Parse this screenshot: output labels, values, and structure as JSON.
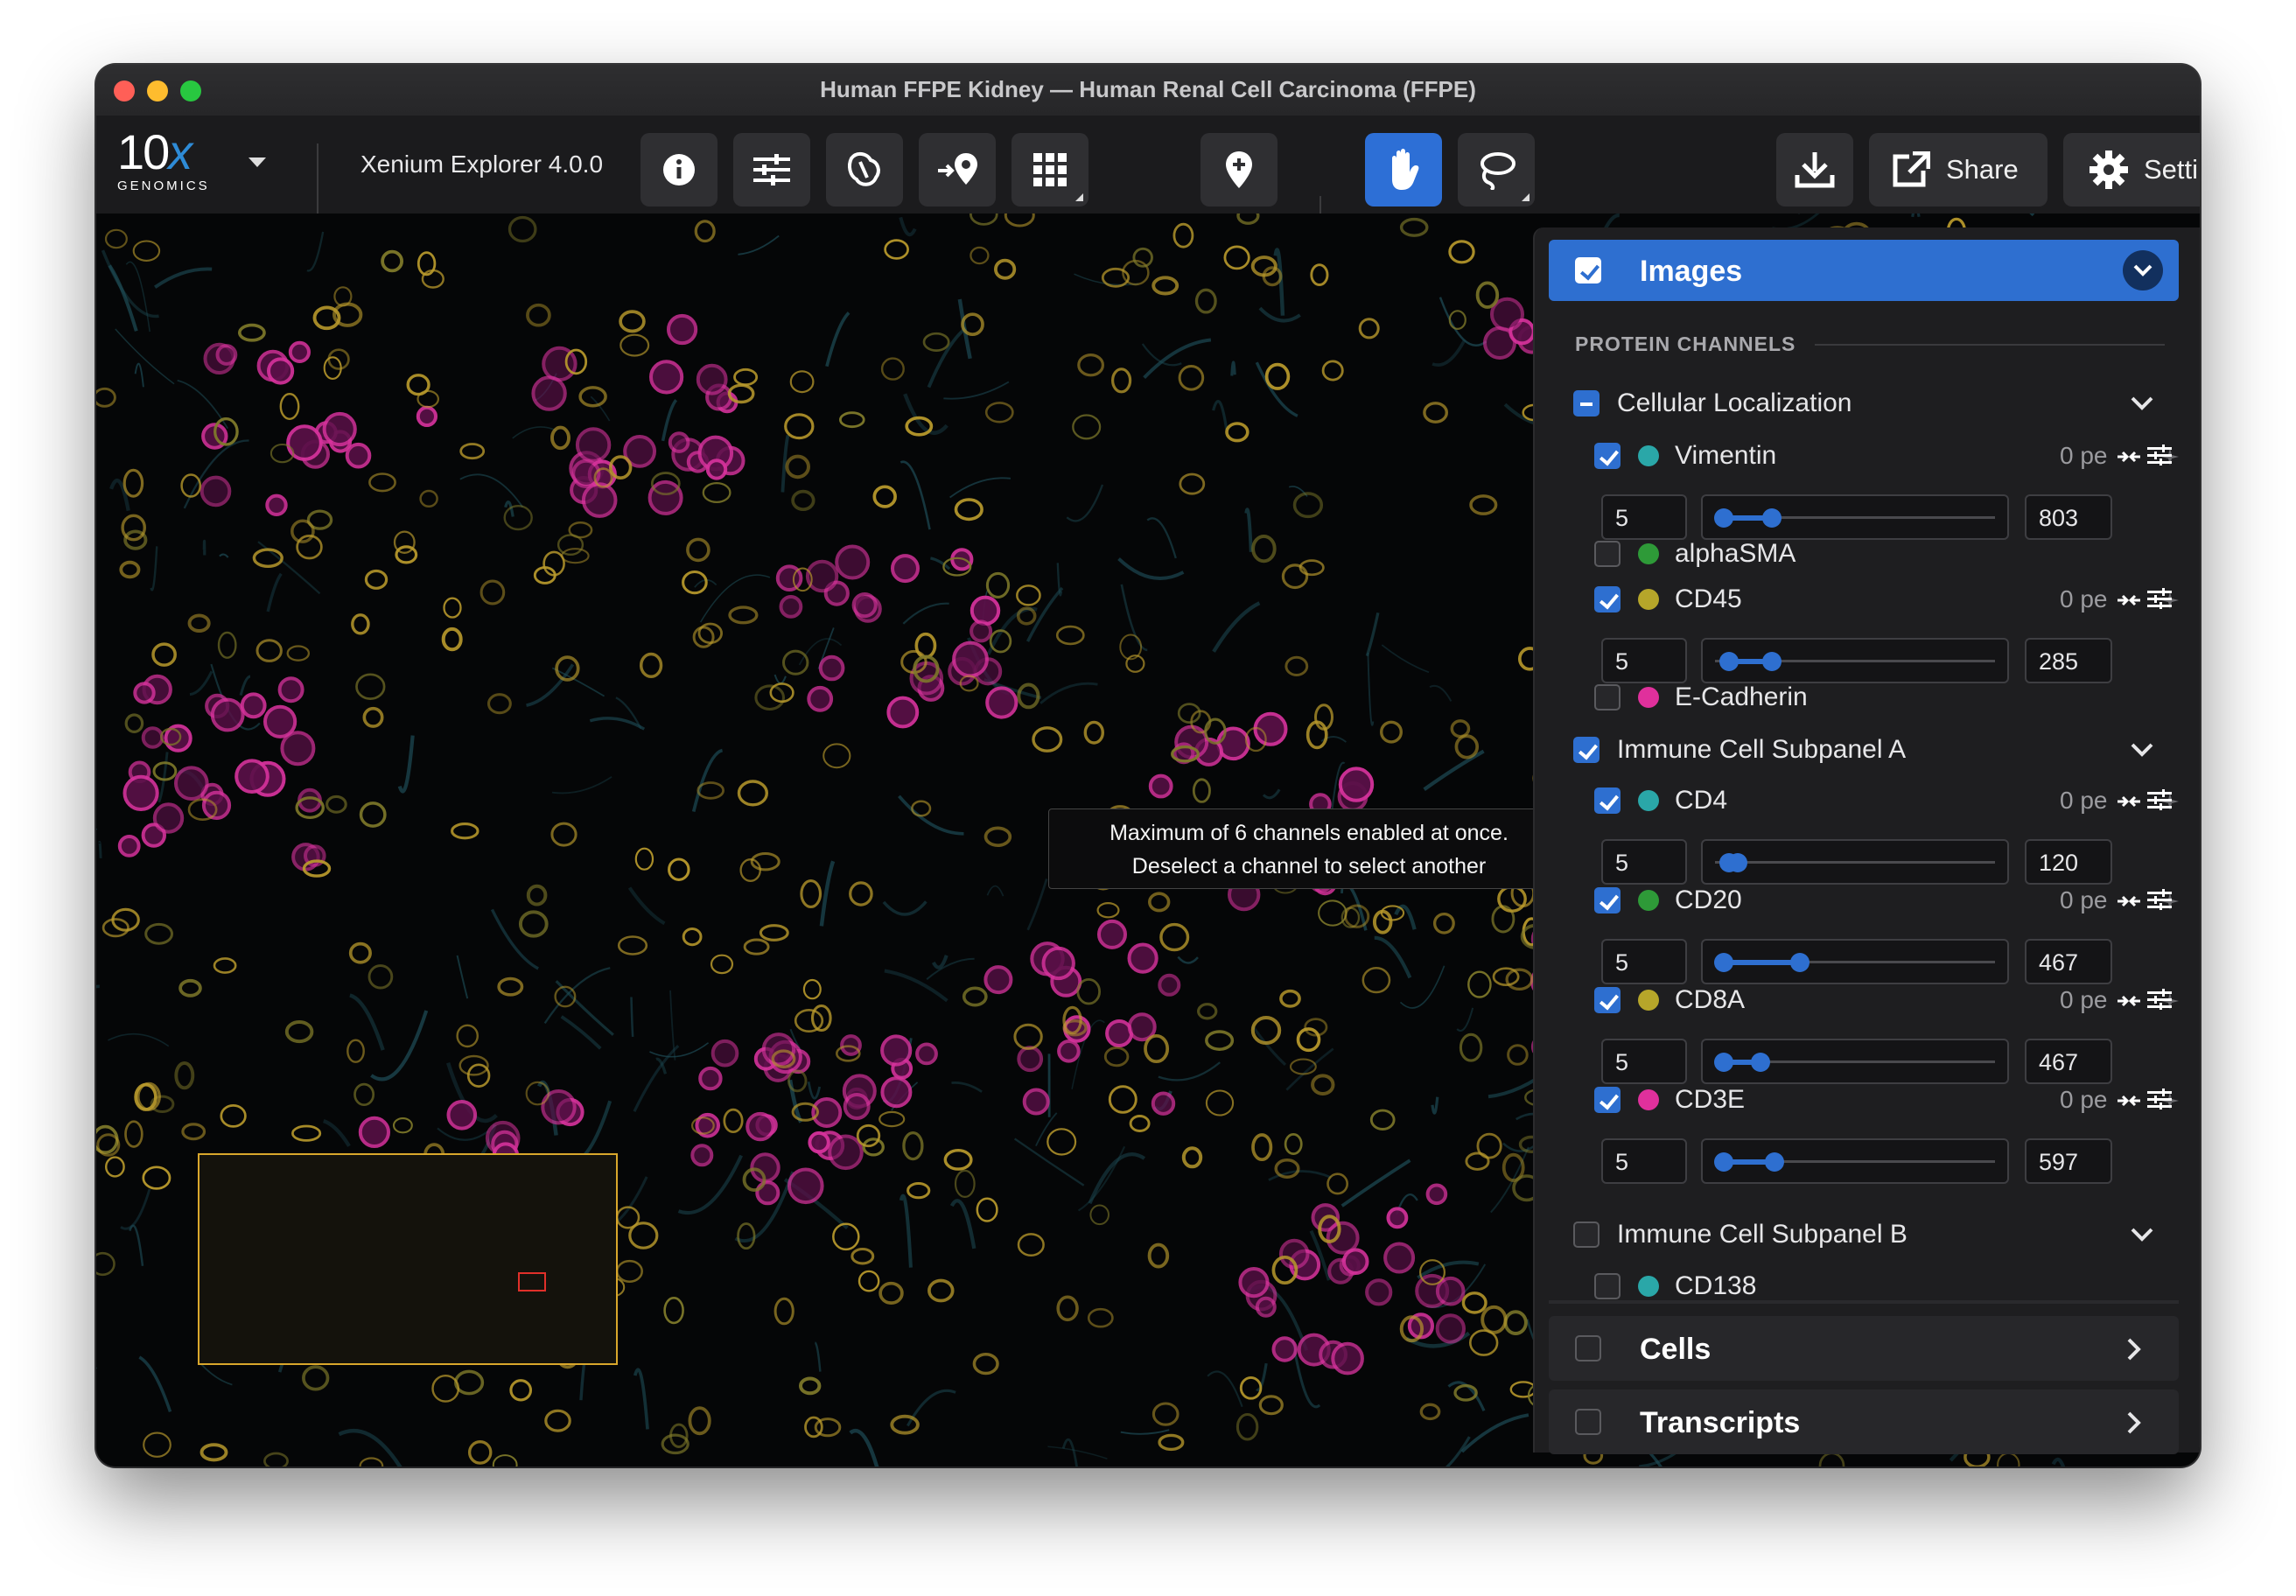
{
  "window": {
    "title": "Human FFPE Kidney — Human Renal Cell Carcinoma (FFPE)"
  },
  "toolbar": {
    "logo_main": "10",
    "logo_x": "x",
    "logo_sub": "GENOMICS",
    "app_name": "Xenium Explorer 4.0.0",
    "share_label": "Share",
    "settings_label": "Settings"
  },
  "tooltip": {
    "line1": "Maximum of 6 channels enabled at once.",
    "line2": "Deselect a channel to select another"
  },
  "panel": {
    "images_label": "Images",
    "section_title": "PROTEIN CHANNELS",
    "groups": [
      {
        "label": "Cellular Localization",
        "state": "partial"
      },
      {
        "label": "Immune Cell Subpanel A",
        "state": "checked"
      },
      {
        "label": "Immune Cell Subpanel B",
        "state": "unchecked"
      }
    ],
    "channels": [
      {
        "name": "Vimentin",
        "color": "#2aa7a8",
        "checked": true,
        "pe": "0 pe",
        "min": "5",
        "max": "803",
        "range": [
          0.03,
          0.2
        ]
      },
      {
        "name": "alphaSMA",
        "color": "#2e9a38",
        "checked": false
      },
      {
        "name": "CD45",
        "color": "#b6a62a",
        "checked": true,
        "pe": "0 pe",
        "min": "5",
        "max": "285",
        "range": [
          0.05,
          0.2
        ]
      },
      {
        "name": "E-Cadherin",
        "color": "#e0309c",
        "checked": false
      },
      {
        "name": "CD4",
        "color": "#2aa7a8",
        "checked": true,
        "pe": "0 pe",
        "min": "5",
        "max": "120",
        "range": [
          0.05,
          0.08
        ]
      },
      {
        "name": "CD20",
        "color": "#2e9a38",
        "checked": true,
        "pe": "0 pe",
        "min": "5",
        "max": "467",
        "range": [
          0.03,
          0.3
        ]
      },
      {
        "name": "CD8A",
        "color": "#b6a62a",
        "checked": true,
        "pe": "0 pe",
        "min": "5",
        "max": "467",
        "range": [
          0.03,
          0.16
        ]
      },
      {
        "name": "CD3E",
        "color": "#e0309c",
        "checked": true,
        "pe": "0 pe",
        "min": "5",
        "max": "597",
        "range": [
          0.03,
          0.21
        ]
      },
      {
        "name": "CD138",
        "color": "#2aa7a8",
        "checked": false
      }
    ],
    "cells_label": "Cells",
    "transcripts_label": "Transcripts"
  },
  "colors": {
    "accent": "#2e6fd0"
  }
}
